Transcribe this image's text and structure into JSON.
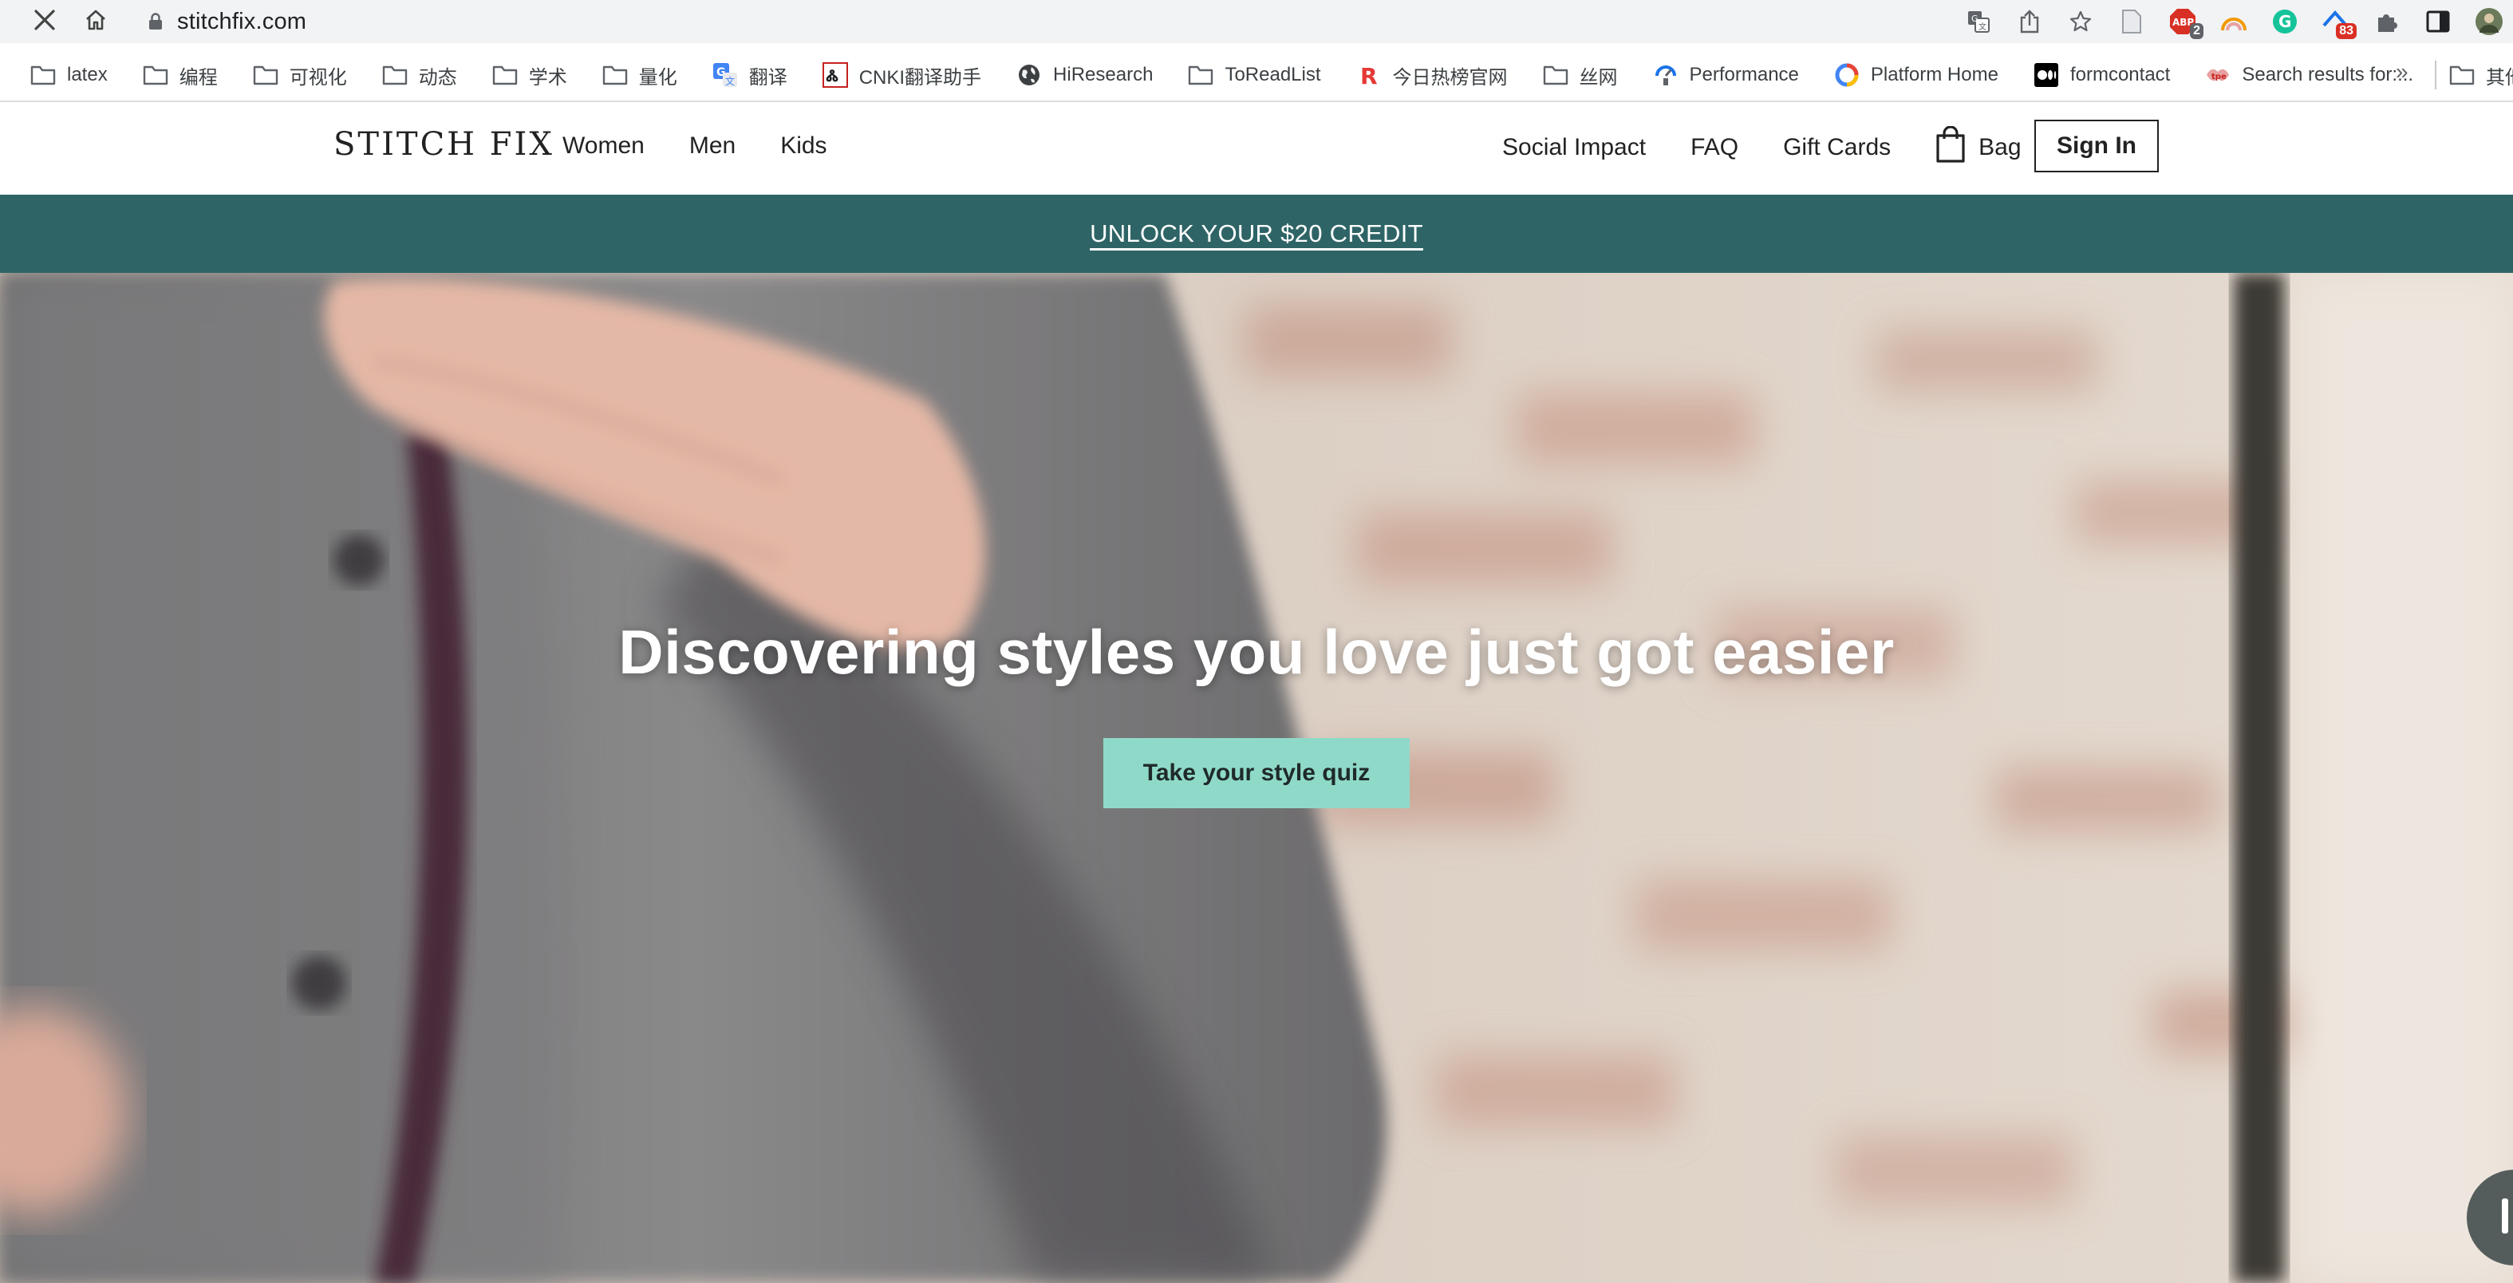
{
  "browser": {
    "url": "stitchfix.com",
    "extension_badges": {
      "abp": "2",
      "mail": "83"
    },
    "bookmarks": [
      {
        "label": "latex",
        "icon": "folder-icon"
      },
      {
        "label": "编程",
        "icon": "folder-icon"
      },
      {
        "label": "可视化",
        "icon": "folder-icon"
      },
      {
        "label": "动态",
        "icon": "folder-icon"
      },
      {
        "label": "学术",
        "icon": "folder-icon"
      },
      {
        "label": "量化",
        "icon": "folder-icon"
      },
      {
        "label": "翻译",
        "icon": "translate-icon"
      },
      {
        "label": "CNKI翻译助手",
        "icon": "cnki-icon"
      },
      {
        "label": "HiResearch",
        "icon": "globe-icon"
      },
      {
        "label": "ToReadList",
        "icon": "folder-icon"
      },
      {
        "label": "今日热榜官网",
        "icon": "r-logo-icon"
      },
      {
        "label": "丝网",
        "icon": "folder-icon"
      },
      {
        "label": "Performance",
        "icon": "performance-icon"
      },
      {
        "label": "Platform Home",
        "icon": "platform-icon"
      },
      {
        "label": "formcontact",
        "icon": "medium-icon"
      },
      {
        "label": "Search results for:...",
        "icon": "search-results-icon"
      }
    ],
    "bookmarks_more": "»",
    "other_bookmarks": "其他"
  },
  "site": {
    "logo": "STITCH FIX",
    "nav_left": [
      "Women",
      "Men",
      "Kids"
    ],
    "nav_right": [
      "Social Impact",
      "FAQ",
      "Gift Cards"
    ],
    "bag_label": "Bag",
    "sign_in": "Sign In",
    "promo": "UNLOCK YOUR $20 CREDIT",
    "hero_title": "Discovering styles you love just got easier",
    "cta": "Take your style quiz"
  },
  "colors": {
    "promo_bg": "#2e6466",
    "cta_bg": "#8fd9c8",
    "text_dark": "#222222"
  }
}
